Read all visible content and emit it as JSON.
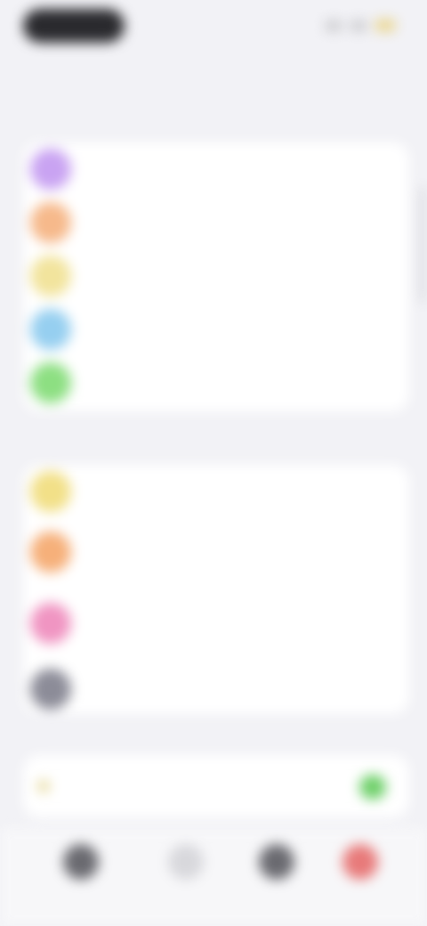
{
  "status": {
    "time": "",
    "battery_color": "#e9d48a"
  },
  "nav": {
    "title": ""
  },
  "sections": [
    {
      "header": "",
      "items": [
        {
          "name": "",
          "subtitle": "",
          "color": "#c9a3f2"
        },
        {
          "name": "",
          "subtitle": "",
          "color": "#f6b98b"
        },
        {
          "name": "",
          "subtitle": "",
          "color": "#f2e49d"
        },
        {
          "name": "",
          "subtitle": "",
          "color": "#96cff0"
        },
        {
          "name": "",
          "subtitle": "",
          "color": "#8ddf82"
        }
      ]
    },
    {
      "header": "",
      "items": [
        {
          "name": "",
          "subtitle": "",
          "color": "#f2e088"
        },
        {
          "name": "",
          "subtitle": "",
          "color": "#f6b07a"
        },
        {
          "name": "",
          "subtitle": "",
          "color": "#f095c2"
        },
        {
          "name": "",
          "subtitle": "",
          "color": "#8c8c98"
        }
      ]
    }
  ],
  "toggle": {
    "label": "",
    "on": true,
    "on_color": "#6fd06a"
  },
  "tabs": [
    {
      "label": "",
      "color": "#6a6a70"
    },
    {
      "label": "",
      "color": "#d8d8dc"
    },
    {
      "label": "",
      "color": "#6a6a70"
    },
    {
      "label": "",
      "color": "#e87a7a"
    }
  ]
}
